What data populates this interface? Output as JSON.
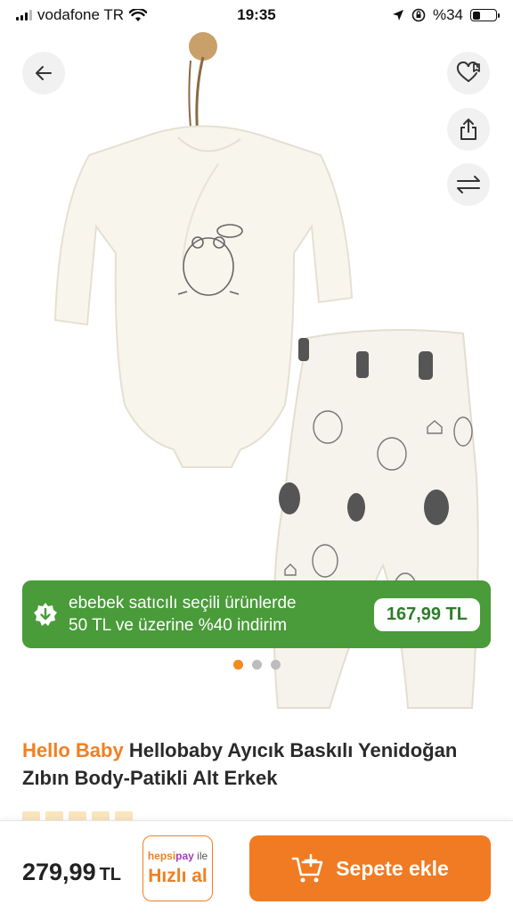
{
  "status_bar": {
    "carrier": "vodafone TR",
    "time": "19:35",
    "battery": "%34",
    "battery_level": 0.34
  },
  "hero": {
    "icons": [
      "arrow-left-icon",
      "heart-icon",
      "share-icon",
      "compare-arrows-icon"
    ]
  },
  "promo": {
    "text_line1": "ebebek satıcılı seçili ürünlerde",
    "text_line2": "50 TL ve üzerine %40 indirim",
    "price": "167,99 TL",
    "color": "#4a9b3a"
  },
  "carousel": {
    "active_index": 0,
    "count": 3
  },
  "product": {
    "brand": "Hello Baby",
    "name": "Hellobaby Ayıcık Baskılı Yenidoğan Zıbın Body-Patikli Alt Erkek"
  },
  "bottom_bar": {
    "price": "279,99",
    "currency": "TL",
    "quick_buy_brand_a": "hepsi",
    "quick_buy_brand_b": "pay",
    "quick_buy_suffix": " ile",
    "quick_buy_label": "Hızlı al",
    "add_to_cart_label": "Sepete ekle",
    "accent_color": "#f07b22"
  }
}
